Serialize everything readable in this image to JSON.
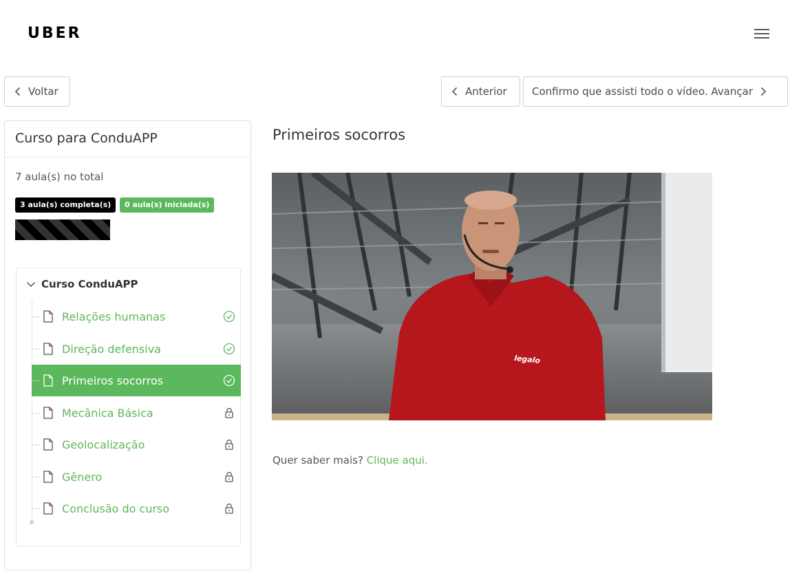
{
  "header": {
    "logo": "UBER",
    "menu_icon": "hamburger-menu-icon"
  },
  "nav": {
    "back_label": "Voltar",
    "prev_label": "Anterior",
    "next_label": "Confirmo que assisti todo o vídeo. Avançar"
  },
  "sidebar": {
    "title": "Curso para ConduAPP",
    "total": "7 aula(s) no total",
    "badge_complete": "3 aula(s) completa(s)",
    "badge_started": "0 aula(s) iniciada(s)",
    "progress_fraction": 0.43,
    "tree": {
      "root_label": "Curso ConduAPP",
      "items": [
        {
          "label": "Relações humanas",
          "status": "completed",
          "active": false
        },
        {
          "label": "Direção defensiva",
          "status": "completed",
          "active": false
        },
        {
          "label": "Primeiros socorros",
          "status": "completed",
          "active": true
        },
        {
          "label": "Mecânica Básica",
          "status": "locked",
          "active": false
        },
        {
          "label": "Geolocalização",
          "status": "locked",
          "active": false
        },
        {
          "label": "Gênero",
          "status": "locked",
          "active": false
        },
        {
          "label": "Conclusão do curso",
          "status": "locked",
          "active": false
        }
      ]
    }
  },
  "main": {
    "title": "Primeiros socorros",
    "more_info_prefix": "Quer saber mais?",
    "more_info_link": "Clique aqui."
  },
  "colors": {
    "accent": "#5cb85c",
    "badge_dark": "#000000"
  }
}
